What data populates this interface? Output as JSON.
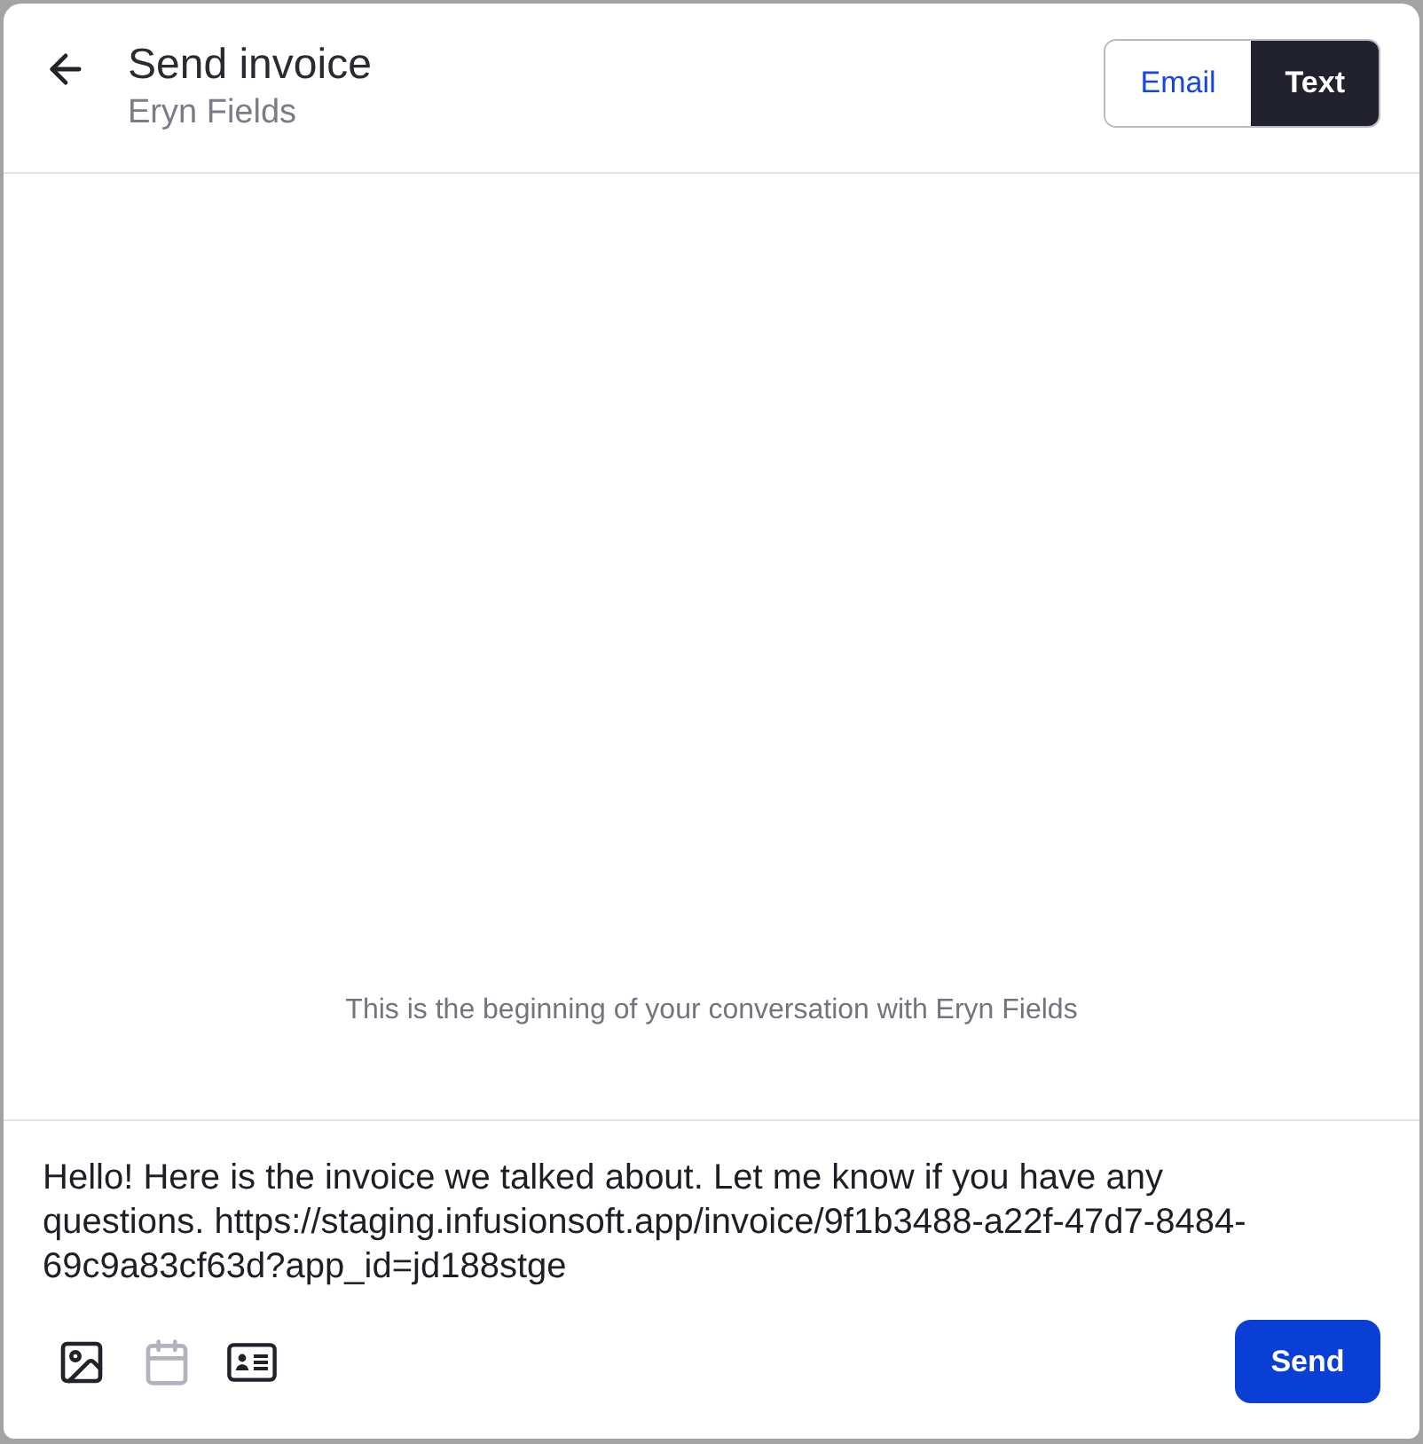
{
  "header": {
    "title": "Send invoice",
    "subtitle": "Eryn Fields"
  },
  "channel_tabs": [
    {
      "label": "Email",
      "selected": false
    },
    {
      "label": "Text",
      "selected": true
    }
  ],
  "conversation": {
    "empty_message": "This is the beginning of your conversation with Eryn Fields"
  },
  "composer": {
    "value": "Hello! Here is the invoice we talked about. Let me know if you have any questions. https://staging.infusionsoft.app/invoice/9f1b3488-a22f-47d7-8484-69c9a83cf63d?app_id=jd188stge",
    "tools": [
      {
        "kind": "image",
        "disabled": false
      },
      {
        "kind": "calendar",
        "disabled": true
      },
      {
        "kind": "contact-card",
        "disabled": false
      }
    ],
    "send_button": "Send"
  }
}
